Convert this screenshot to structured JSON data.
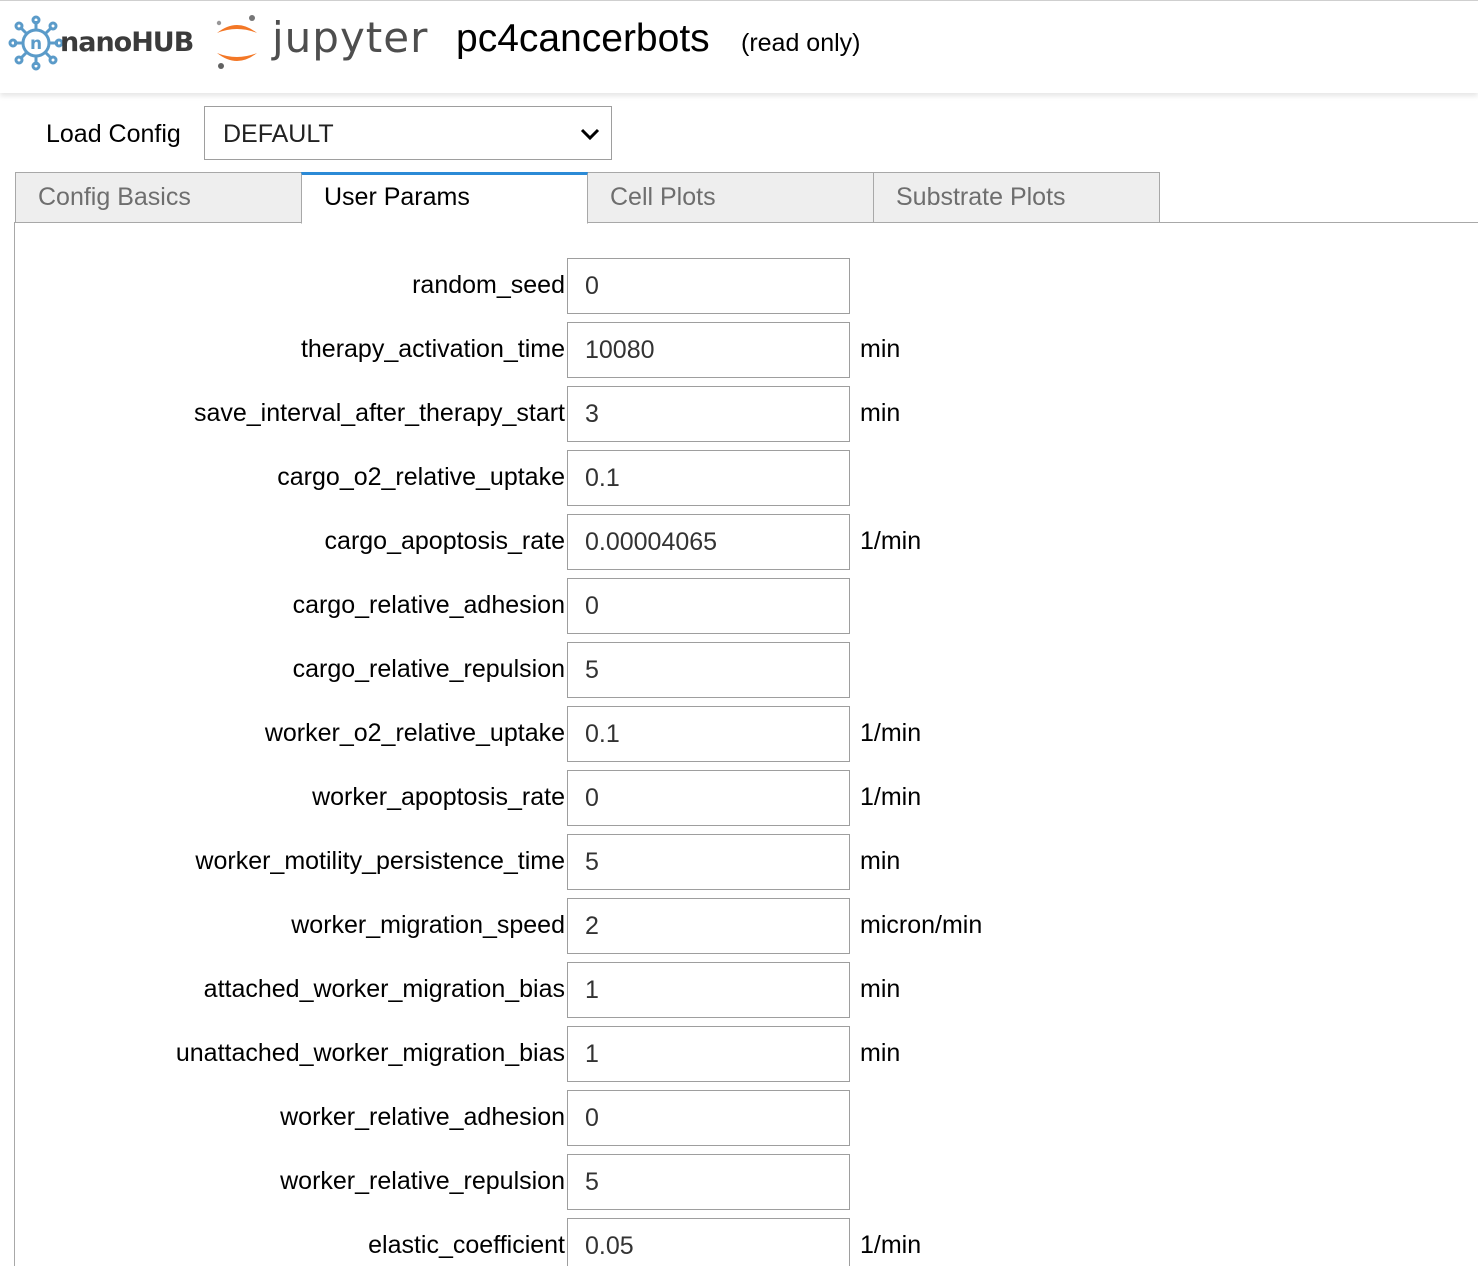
{
  "header": {
    "nanohub_label": "nanoHUB",
    "jupyter_label": "jupyter",
    "notebook_name": "pc4cancerbots",
    "status": "(read only)"
  },
  "load_config": {
    "label": "Load Config",
    "selected": "DEFAULT"
  },
  "tabs": [
    {
      "label": "Config Basics",
      "active": false
    },
    {
      "label": "User Params",
      "active": true
    },
    {
      "label": "Cell Plots",
      "active": false
    },
    {
      "label": "Substrate Plots",
      "active": false
    }
  ],
  "colors": {
    "tab_accent": "#2b8ad6",
    "jupyter_orange": "#f37726",
    "nanohub_blue": "#5b9bc9"
  },
  "params": [
    {
      "name": "random_seed",
      "value": "0",
      "unit": ""
    },
    {
      "name": "therapy_activation_time",
      "value": "10080",
      "unit": "min"
    },
    {
      "name": "save_interval_after_therapy_start",
      "value": "3",
      "unit": "min"
    },
    {
      "name": "cargo_o2_relative_uptake",
      "value": "0.1",
      "unit": ""
    },
    {
      "name": "cargo_apoptosis_rate",
      "value": "0.00004065",
      "unit": "1/min"
    },
    {
      "name": "cargo_relative_adhesion",
      "value": "0",
      "unit": ""
    },
    {
      "name": "cargo_relative_repulsion",
      "value": "5",
      "unit": ""
    },
    {
      "name": "worker_o2_relative_uptake",
      "value": "0.1",
      "unit": "1/min"
    },
    {
      "name": "worker_apoptosis_rate",
      "value": "0",
      "unit": "1/min"
    },
    {
      "name": "worker_motility_persistence_time",
      "value": "5",
      "unit": "min"
    },
    {
      "name": "worker_migration_speed",
      "value": "2",
      "unit": "micron/min"
    },
    {
      "name": "attached_worker_migration_bias",
      "value": "1",
      "unit": "min"
    },
    {
      "name": "unattached_worker_migration_bias",
      "value": "1",
      "unit": "min"
    },
    {
      "name": "worker_relative_adhesion",
      "value": "0",
      "unit": ""
    },
    {
      "name": "worker_relative_repulsion",
      "value": "5",
      "unit": ""
    },
    {
      "name": "elastic_coefficient",
      "value": "0.05",
      "unit": "1/min"
    }
  ]
}
